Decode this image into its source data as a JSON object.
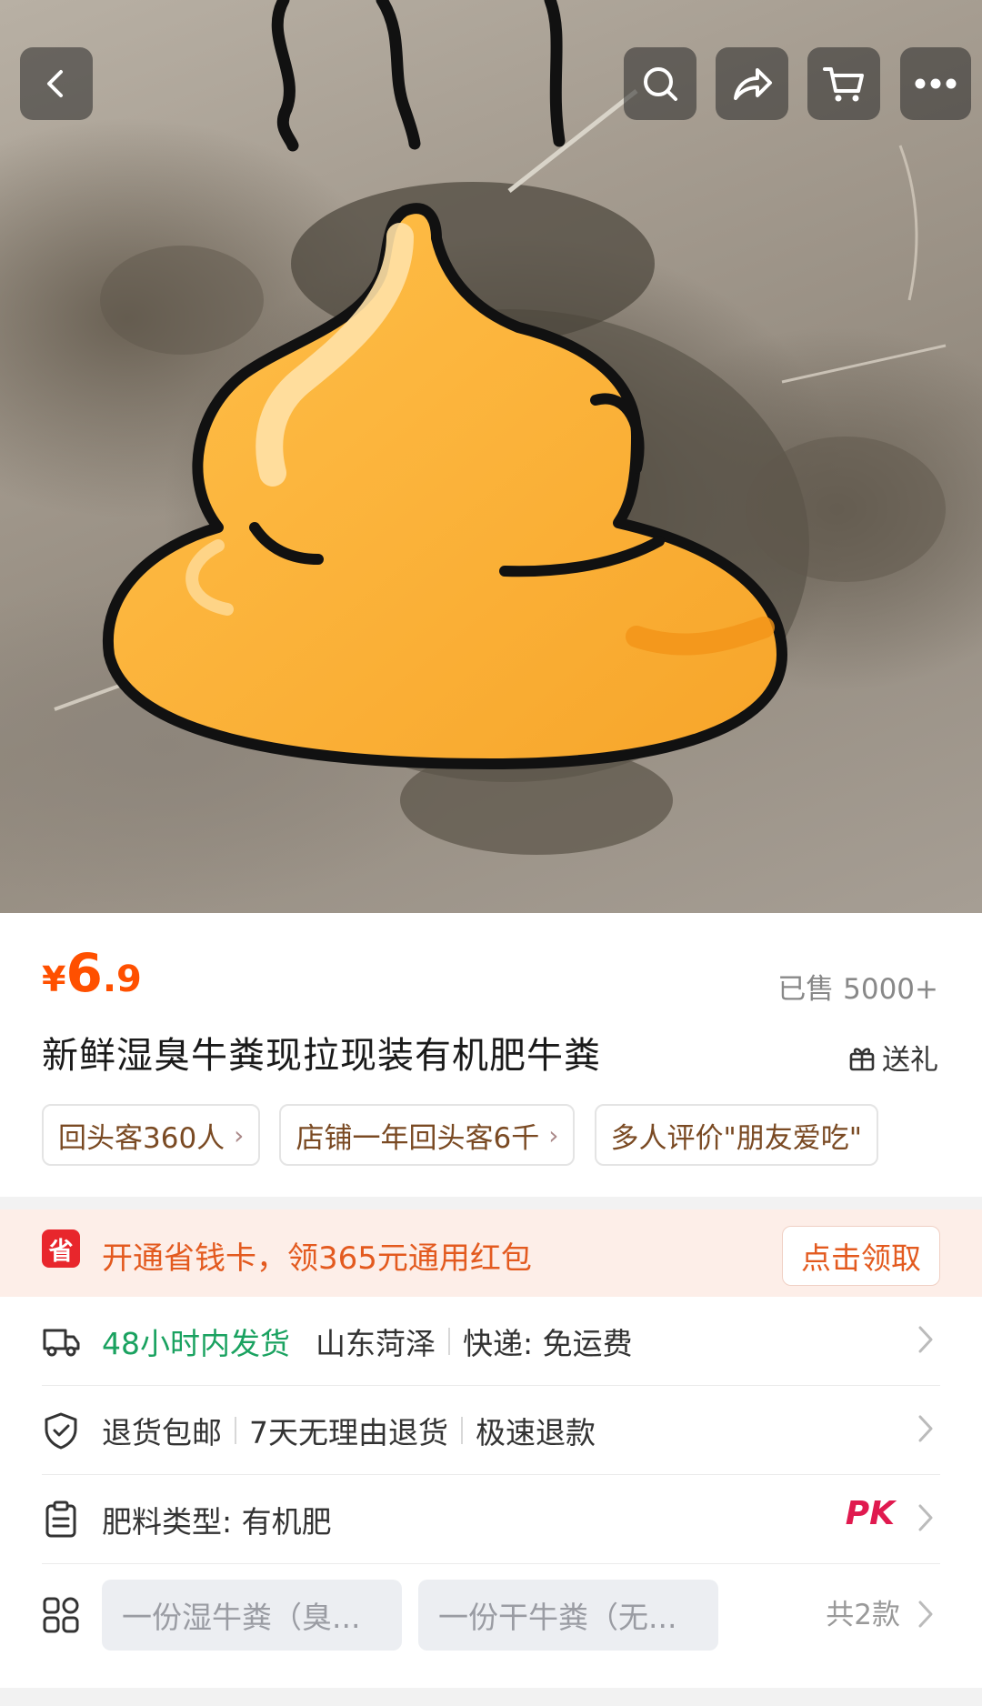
{
  "toolbar": {
    "back_icon": "chevron-left-icon",
    "search_icon": "search-icon",
    "share_icon": "share-icon",
    "cart_icon": "cart-icon",
    "more_icon": "more-icon"
  },
  "product": {
    "price_currency": "¥",
    "price_integer": "6",
    "price_decimal": ".9",
    "sold": "已售 5000+",
    "title": "新鲜湿臭牛粪现拉现装有机肥牛粪",
    "gift_label": "送礼",
    "tags": [
      {
        "label": "回头客360人",
        "chevron": "›"
      },
      {
        "label": "店铺一年回头客6千",
        "chevron": "›"
      },
      {
        "label": "多人评价\"朋友爱吃\"",
        "chevron": ""
      }
    ]
  },
  "promo": {
    "icon_text": "省",
    "text": "开通省钱卡，领365元通用红包",
    "button": "点击领取"
  },
  "shipping": {
    "speed": "48小时内发货",
    "origin": "山东菏泽",
    "delivery": "快递: 免运费"
  },
  "returns": {
    "item1": "退货包邮",
    "item2": "7天无理由退货",
    "item3": "极速退款"
  },
  "spec": {
    "text": "肥料类型: 有机肥",
    "pk": "PK"
  },
  "variants": {
    "options": [
      "一份湿牛粪（臭...",
      "一份干牛粪（无..."
    ],
    "count": "共2款"
  },
  "colors": {
    "accent": "#ff5000",
    "green": "#1aa260",
    "promo_bg": "#fdeee8",
    "pk": "#e01a4f"
  }
}
